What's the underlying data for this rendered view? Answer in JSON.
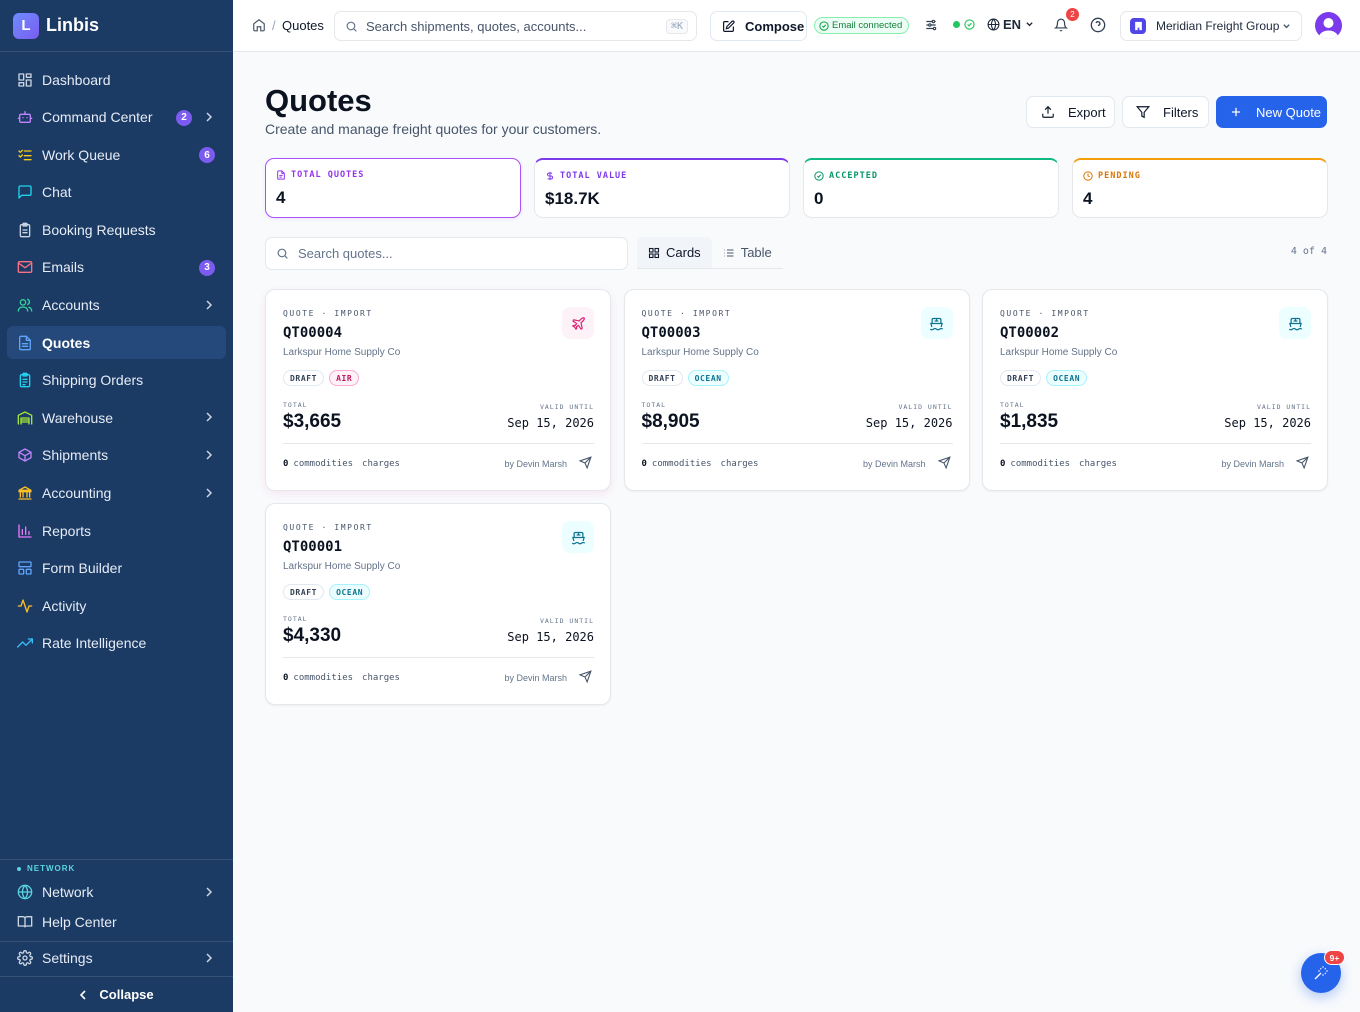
{
  "brand": {
    "logo_letter": "L",
    "name": "Linbis"
  },
  "sidebar": {
    "items": [
      {
        "label": "Dashboard",
        "icon": "layout-grid-icon"
      },
      {
        "label": "Command Center",
        "icon": "robot-icon",
        "badge": "2",
        "has_children": true
      },
      {
        "label": "Work Queue",
        "icon": "list-checks-icon",
        "badge": "6"
      },
      {
        "label": "Chat",
        "icon": "chat-icon"
      },
      {
        "label": "Booking Requests",
        "icon": "clipboard-icon"
      },
      {
        "label": "Emails",
        "icon": "mail-icon",
        "badge": "3"
      },
      {
        "label": "Accounts",
        "icon": "users-icon",
        "has_children": true
      },
      {
        "label": "Quotes",
        "icon": "file-text-icon",
        "active": true
      },
      {
        "label": "Shipping Orders",
        "icon": "clipboard-list-icon"
      },
      {
        "label": "Warehouse",
        "icon": "warehouse-icon",
        "has_children": true
      },
      {
        "label": "Shipments",
        "icon": "package-icon",
        "has_children": true
      },
      {
        "label": "Accounting",
        "icon": "bank-icon",
        "has_children": true
      },
      {
        "label": "Reports",
        "icon": "bar-chart-icon"
      },
      {
        "label": "Form Builder",
        "icon": "layout-icon"
      },
      {
        "label": "Activity",
        "icon": "activity-icon"
      },
      {
        "label": "Rate Intelligence",
        "icon": "trending-up-icon"
      }
    ],
    "network_section_label": "NETWORK",
    "network_label": "Network",
    "help_label": "Help Center",
    "settings_label": "Settings",
    "collapse_label": "Collapse"
  },
  "topbar": {
    "breadcrumb": "Quotes",
    "search_placeholder": "Search shipments, quotes, accounts...",
    "search_shortcut": "⌘K",
    "compose_label": "Compose",
    "email_status": "Email connected",
    "language": "EN",
    "notifications_count": "2",
    "org_name": "Meridian Freight Group"
  },
  "page": {
    "title": "Quotes",
    "subtitle": "Create and manage freight quotes for your customers.",
    "export_label": "Export",
    "filters_label": "Filters",
    "new_label": "New Quote"
  },
  "stats": [
    {
      "label": "TOTAL QUOTES",
      "value": "4",
      "color": "#a855f7"
    },
    {
      "label": "TOTAL VALUE",
      "value": "$18.7K",
      "color": "#7c3aed"
    },
    {
      "label": "ACCEPTED",
      "value": "0",
      "color": "#10b981"
    },
    {
      "label": "PENDING",
      "value": "4",
      "color": "#f59e0b"
    }
  ],
  "list": {
    "search_placeholder": "Search quotes...",
    "view_cards": "Cards",
    "view_table": "Table",
    "count": "4 of 4"
  },
  "quotes": [
    {
      "kind": "QUOTE · IMPORT",
      "id": "QT00004",
      "customer": "Larkspur Home Supply Co",
      "status": "DRAFT",
      "mode": "AIR",
      "total_label": "TOTAL",
      "total": "$3,665",
      "valid_label": "VALID UNTIL",
      "valid_until": "Sep 15, 2026",
      "commodities_count": "0",
      "commodities_label": "commodities",
      "charges_label": "charges",
      "by": "by Devin Marsh"
    },
    {
      "kind": "QUOTE · IMPORT",
      "id": "QT00003",
      "customer": "Larkspur Home Supply Co",
      "status": "DRAFT",
      "mode": "OCEAN",
      "total_label": "TOTAL",
      "total": "$8,905",
      "valid_label": "VALID UNTIL",
      "valid_until": "Sep 15, 2026",
      "commodities_count": "0",
      "commodities_label": "commodities",
      "charges_label": "charges",
      "by": "by Devin Marsh"
    },
    {
      "kind": "QUOTE · IMPORT",
      "id": "QT00002",
      "customer": "Larkspur Home Supply Co",
      "status": "DRAFT",
      "mode": "OCEAN",
      "total_label": "TOTAL",
      "total": "$1,835",
      "valid_label": "VALID UNTIL",
      "valid_until": "Sep 15, 2026",
      "commodities_count": "0",
      "commodities_label": "commodities",
      "charges_label": "charges",
      "by": "by Devin Marsh"
    },
    {
      "kind": "QUOTE · IMPORT",
      "id": "QT00001",
      "customer": "Larkspur Home Supply Co",
      "status": "DRAFT",
      "mode": "OCEAN",
      "total_label": "TOTAL",
      "total": "$4,330",
      "valid_label": "VALID UNTIL",
      "valid_until": "Sep 15, 2026",
      "commodities_count": "0",
      "commodities_label": "commodities",
      "charges_label": "charges",
      "by": "by Devin Marsh"
    }
  ],
  "fab": {
    "badge": "9+"
  }
}
